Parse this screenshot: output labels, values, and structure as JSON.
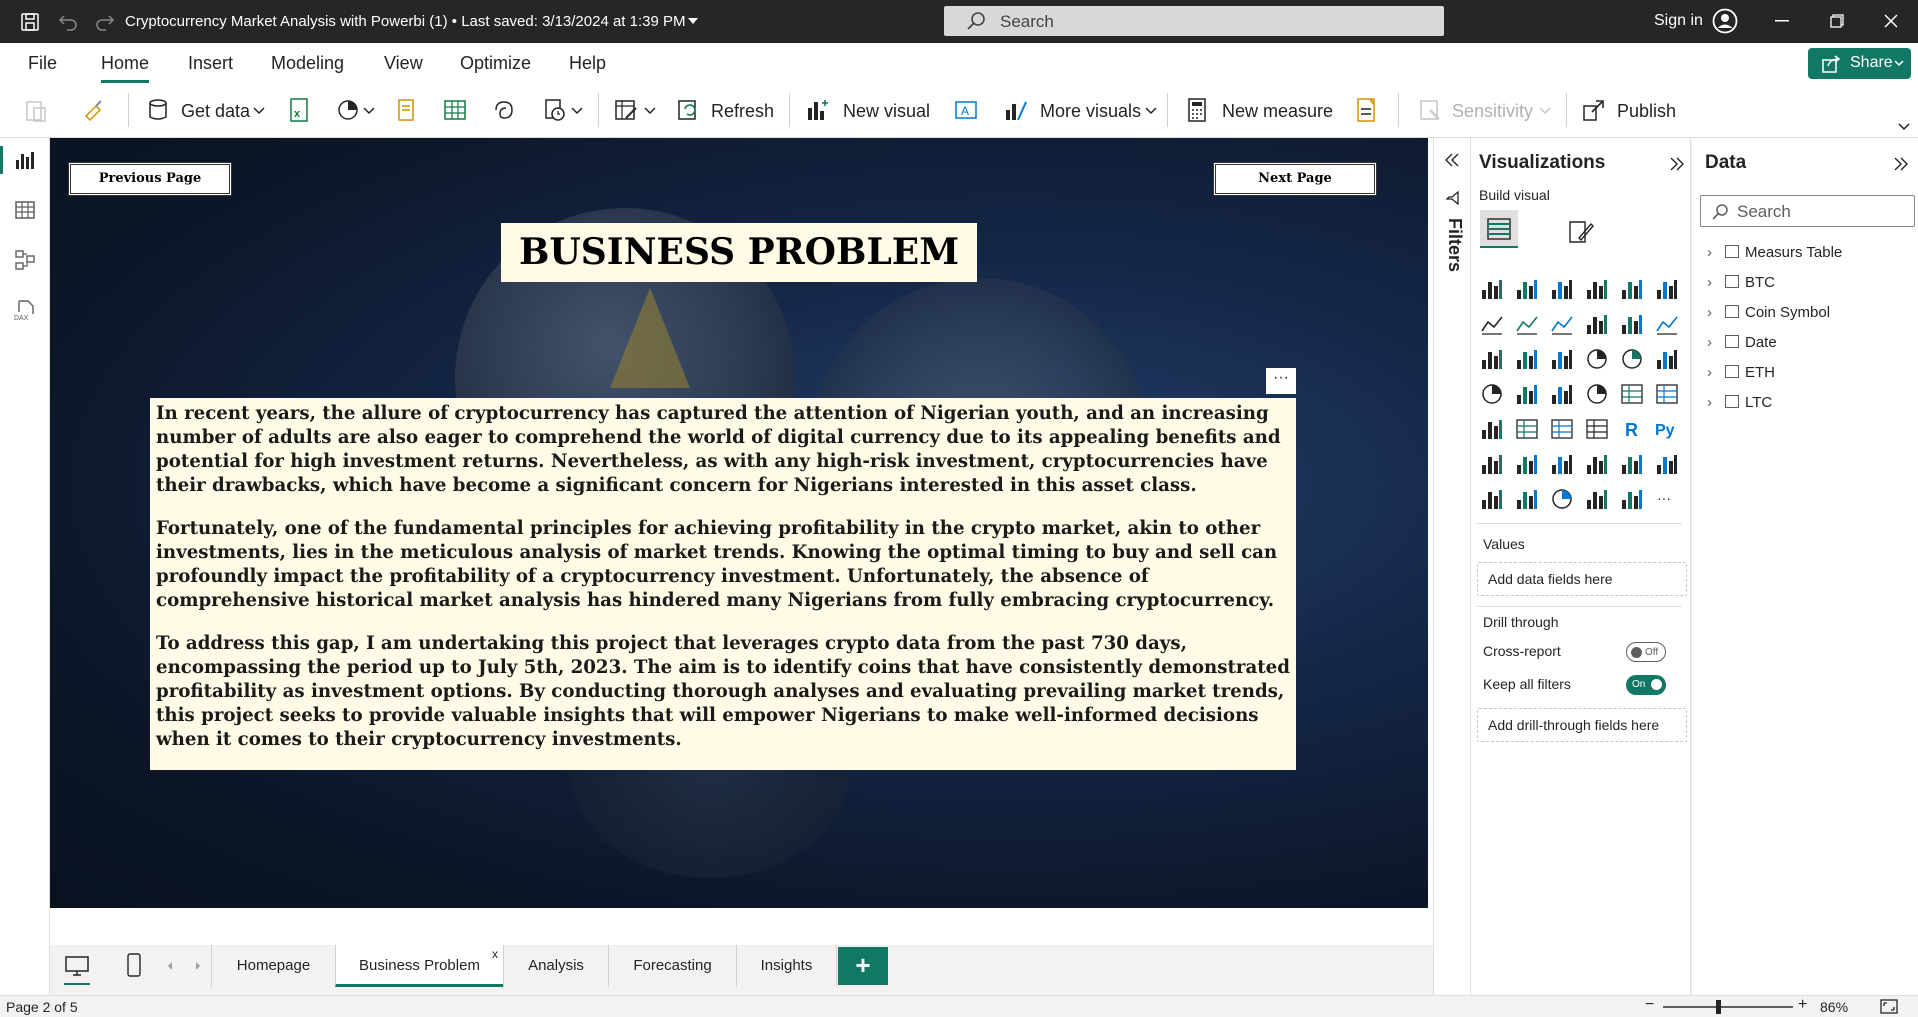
{
  "titlebar": {
    "title": "Cryptocurrency Market Analysis with Powerbi (1) • Last saved: 3/13/2024 at 1:39 PM",
    "search_placeholder": "Search",
    "signin": "Sign in"
  },
  "menu": {
    "tabs": [
      "File",
      "Home",
      "Insert",
      "Modeling",
      "View",
      "Optimize",
      "Help"
    ],
    "active": "Home",
    "share": "Share"
  },
  "ribbon": {
    "get_data": "Get data",
    "refresh": "Refresh",
    "new_visual": "New visual",
    "more_visuals": "More visuals",
    "new_measure": "New measure",
    "sensitivity": "Sensitivity",
    "publish": "Publish"
  },
  "report": {
    "prev_page": "Previous Page",
    "next_page": "Next Page",
    "title": "BUSINESS PROBLEM",
    "more_options": "···",
    "paragraphs": [
      "In recent years, the allure of cryptocurrency has captured the attention of Nigerian youth, and an increasing number of adults are also eager to comprehend the world of digital currency due to its appealing benefits and potential for high investment returns. Nevertheless, as with any high-risk investment, cryptocurrencies have their drawbacks, which have become a significant concern for Nigerians interested in this asset class.",
      "Fortunately, one of the fundamental principles for achieving profitability in the crypto market, akin to other investments, lies in the meticulous analysis of market trends. Knowing the optimal timing to buy and sell can profoundly impact the profitability of a cryptocurrency investment. Unfortunately, the absence of comprehensive historical market analysis has hindered many Nigerians from fully embracing cryptocurrency.",
      "To address this gap, I am undertaking this project that leverages crypto data from the past 730 days, encompassing the period up to July 5th, 2023. The aim is to identify coins that have consistently demonstrated profitability as investment options. By conducting thorough analyses and evaluating prevailing market trends, this project seeks to provide valuable insights that will empower Nigerians to make well-informed decisions when it comes to their cryptocurrency investments."
    ]
  },
  "filters": {
    "label": "Filters"
  },
  "visualizations": {
    "title": "Visualizations",
    "build_visual": "Build visual",
    "values_label": "Values",
    "values_placeholder": "Add data fields here",
    "drill_through": "Drill through",
    "cross_report": "Cross-report",
    "cross_report_state": "Off",
    "keep_filters": "Keep all filters",
    "keep_filters_state": "On",
    "drill_placeholder": "Add drill-through fields here",
    "r_label": "R",
    "py_label": "Py",
    "more": "···"
  },
  "data_pane": {
    "title": "Data",
    "search_placeholder": "Search",
    "tables": [
      "Measurs Table",
      "BTC",
      "Coin Symbol",
      "Date",
      "ETH",
      "LTC"
    ]
  },
  "pages": {
    "tabs": [
      "Homepage",
      "Business Problem",
      "Analysis",
      "Forecasting",
      "Insights"
    ],
    "active": "Business Problem",
    "close": "x",
    "add": "+"
  },
  "status": {
    "page_info": "Page 2 of 5",
    "zoom": "86%"
  },
  "colors": {
    "accent": "#117865",
    "titlebar": "#262626",
    "textbox_bg": "#fffbe6"
  }
}
